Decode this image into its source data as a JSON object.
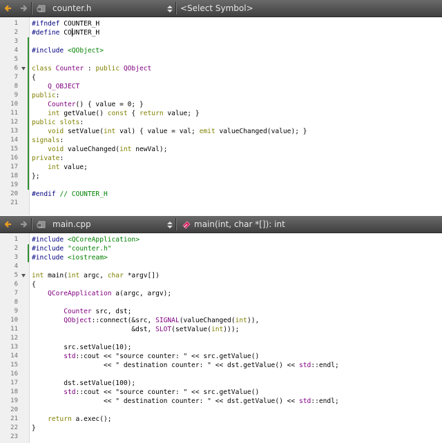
{
  "editors": [
    {
      "filename": "counter.h",
      "symbol": "<Select Symbol>",
      "symbol_icon": null,
      "first_line": 1,
      "lines": [
        "#ifndef COUNTER_H",
        "#define COUNTER_H",
        "",
        "#include <QObject>",
        "",
        "class Counter : public QObject",
        "{",
        "    Q_OBJECT",
        "public:",
        "    Counter() { value = 0; }",
        "    int getValue() const { return value; }",
        "public slots:",
        "    void setValue(int val) { value = val; emit valueChanged(value); }",
        "signals:",
        "    void valueChanged(int newVal);",
        "private:",
        "    int value;",
        "};",
        "",
        "#endif // COUNTER_H",
        ""
      ],
      "fold_lines": [
        6
      ],
      "modified_ranges": [
        [
          3,
          19
        ]
      ],
      "cursor_line": 2,
      "cursor_col": 10
    },
    {
      "filename": "main.cpp",
      "symbol": "main(int, char *[]): int",
      "symbol_icon": "function-icon",
      "first_line": 1,
      "lines": [
        "#include <QCoreApplication>",
        "#include \"counter.h\"",
        "#include <iostream>",
        "",
        "int main(int argc, char *argv[])",
        "{",
        "    QCoreApplication a(argc, argv);",
        "",
        "        Counter src, dst;",
        "        QObject::connect(&src, SIGNAL(valueChanged(int)),",
        "                         &dst, SLOT(setValue(int)));",
        "",
        "        src.setValue(10);",
        "        std::cout << \"source counter: \" << src.getValue()",
        "                  << \" destination counter: \" << dst.getValue() << std::endl;",
        "",
        "        dst.setValue(100);",
        "        std::cout << \"source counter: \" << src.getValue()",
        "                  << \" destination counter: \" << dst.getValue() << std::endl;",
        "",
        "    return a.exec();",
        "}",
        ""
      ],
      "fold_lines": [
        5
      ],
      "modified_ranges": [
        [
          2,
          3
        ]
      ],
      "cursor_line": null,
      "cursor_col": null
    }
  ],
  "colors": {
    "keyword": "#808000",
    "preprocessor": "#000080",
    "include_path": "#008000",
    "type": "#800080",
    "comment": "#008000",
    "modified_marker": "#2f8f2f",
    "toolbar_arrow": "#f0a020"
  }
}
